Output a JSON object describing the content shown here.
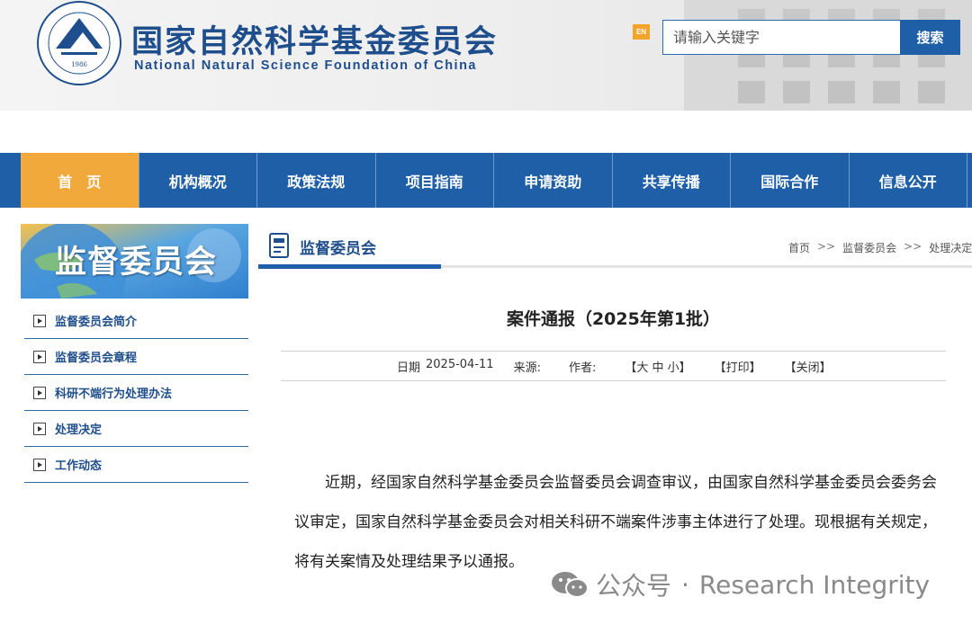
{
  "header": {
    "title_cn": "国家自然科学基金委员会",
    "title_en": "National Natural Science Foundation of China",
    "logo_text_cn": "国家自然科学基金委员会",
    "logo_text_en": "NATIONAL NATURAL SCIENCE FOUNDATION OF CHINA",
    "logo_year": "1986",
    "en_label": "EN",
    "search_placeholder": "请输入关键字",
    "search_button": "搜索"
  },
  "nav": {
    "items": [
      {
        "label": "首页",
        "active": true
      },
      {
        "label": "机构概况"
      },
      {
        "label": "政策法规"
      },
      {
        "label": "项目指南"
      },
      {
        "label": "申请资助"
      },
      {
        "label": "共享传播"
      },
      {
        "label": "国际合作"
      },
      {
        "label": "信息公开"
      }
    ]
  },
  "sidebar": {
    "banner_title": "监督委员会",
    "items": [
      {
        "label": "监督委员会简介"
      },
      {
        "label": "监督委员会章程"
      },
      {
        "label": "科研不端行为处理办法"
      },
      {
        "label": "处理决定"
      },
      {
        "label": "工作动态"
      }
    ]
  },
  "section": {
    "title": "监督委员会",
    "breadcrumb": [
      "首页",
      "监督委员会",
      "处理决定"
    ],
    "breadcrumb_sep": ">>"
  },
  "article": {
    "title": "案件通报（2025年第1批）",
    "date_label": "日期",
    "date": "2025-04-11",
    "source_label": "来源:",
    "author_label": "作者:",
    "font_sizes": "【大 中 小】",
    "print": "【打印】",
    "close": "【关闭】",
    "body": "近期，经国家自然科学基金委员会监督委员会调查审议，由国家自然科学基金委员会委务会议审定，国家自然科学基金委员会对相关科研不端案件涉事主体进行了处理。现根据有关规定，将有关案情及处理结果予以通报。"
  },
  "watermark": {
    "account": "公众号",
    "dot": "·",
    "name": "Research Integrity"
  },
  "colors": {
    "brand_blue": "#1f5fa8",
    "active_orange": "#f0a93a"
  }
}
